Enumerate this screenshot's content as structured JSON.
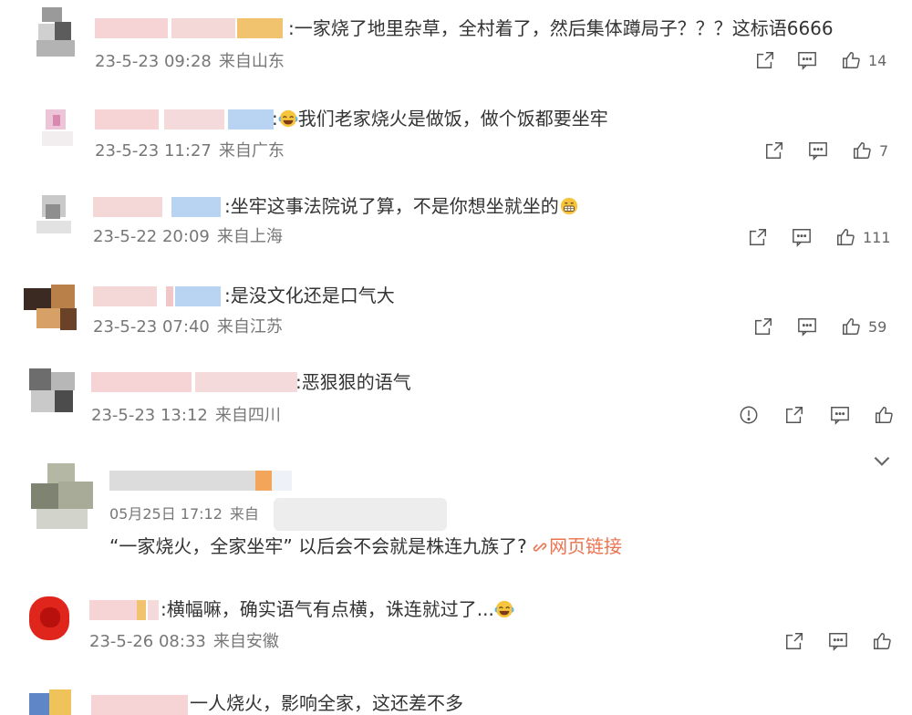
{
  "comments": [
    {
      "content": ":一家烧了地里杂草，全村着了，然后集体蹲局子？？？这标语6666",
      "date": "23-5-23 09:28",
      "location": "来自山东",
      "likes": "14"
    },
    {
      "emoji": "laughing-tears-emoji",
      "content": "我们老家烧火是做饭，做个饭都要坐牢",
      "prefix": ":",
      "date": "23-5-23 11:27",
      "location": "来自广东",
      "likes": "7"
    },
    {
      "content": ":坐牢这事法院说了算，不是你想坐就坐的",
      "emoji": "grin-emoji",
      "date": "23-5-22 20:09",
      "location": "来自上海",
      "likes": "111"
    },
    {
      "content": ":是没文化还是口气大",
      "date": "23-5-23 07:40",
      "location": "来自江苏",
      "likes": "59"
    },
    {
      "content": ":恶狠狠的语气",
      "date": "23-5-23 13:12",
      "location": "来自四川",
      "likes": ""
    },
    {
      "content_quote": "“一家烧火，全家坐牢” 以后会不会就是株连九族了?",
      "link_label": "网页链接",
      "date": "05月25日 17:12",
      "location_partial": "来自"
    },
    {
      "content": ":横幅嘛，确实语气有点横，诛连就过了...",
      "emoji": "laughing-tears-emoji",
      "date": "23-5-26 08:33",
      "location": "来自安徽",
      "likes": ""
    },
    {
      "content": "一人烧火，影响全家，这还差不多"
    }
  ],
  "icons": {
    "share": "share-icon",
    "reply": "comment-icon",
    "like": "thumbs-up-icon",
    "report": "report-icon",
    "expand": "chevron-down-icon"
  },
  "colors": {
    "link": "#eb7350",
    "meta": "#777777"
  }
}
